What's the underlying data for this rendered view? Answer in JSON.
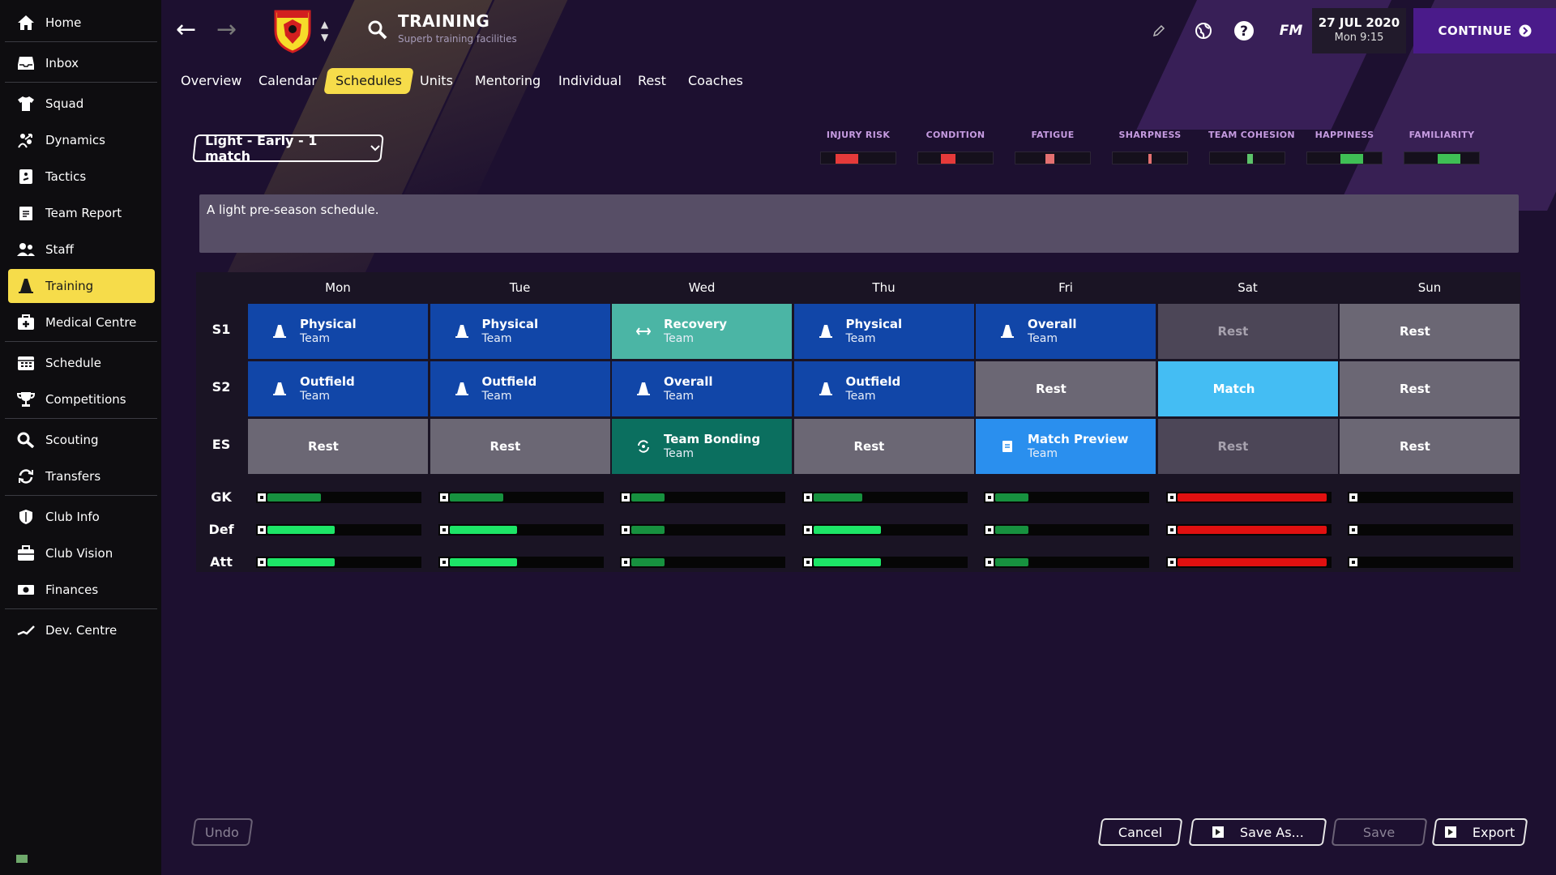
{
  "sidebar": {
    "items": [
      {
        "label": "Home",
        "icon": "home-icon"
      },
      {
        "label": "Inbox",
        "icon": "inbox-icon"
      },
      {
        "label": "Squad",
        "icon": "shirt-icon"
      },
      {
        "label": "Dynamics",
        "icon": "dynamics-icon"
      },
      {
        "label": "Tactics",
        "icon": "tactics-board-icon"
      },
      {
        "label": "Team Report",
        "icon": "report-icon"
      },
      {
        "label": "Staff",
        "icon": "staff-icon"
      },
      {
        "label": "Training",
        "icon": "training-cone-icon",
        "active": true
      },
      {
        "label": "Medical Centre",
        "icon": "medical-kit-icon"
      },
      {
        "label": "Schedule",
        "icon": "calendar-icon"
      },
      {
        "label": "Competitions",
        "icon": "trophy-icon"
      },
      {
        "label": "Scouting",
        "icon": "magnifier-icon"
      },
      {
        "label": "Transfers",
        "icon": "transfer-arrows-icon"
      },
      {
        "label": "Club Info",
        "icon": "shield-icon"
      },
      {
        "label": "Club Vision",
        "icon": "briefcase-icon"
      },
      {
        "label": "Finances",
        "icon": "money-icon"
      },
      {
        "label": "Dev. Centre",
        "icon": "growth-chart-icon"
      }
    ]
  },
  "header": {
    "title": "TRAINING",
    "subtitle": "Superb training facilities",
    "fm_label": "FM",
    "date": "27 JUL 2020",
    "time": "Mon 9:15",
    "continue_label": "CONTINUE"
  },
  "tabs": [
    "Overview",
    "Calendar",
    "Schedules",
    "Units",
    "Mentoring",
    "Individual",
    "Rest",
    "Coaches"
  ],
  "active_tab": "Schedules",
  "schedule_select": "Light - Early - 1 match",
  "meters": [
    {
      "label": "INJURY RISK",
      "color": "#e53a3a",
      "level": 0.3
    },
    {
      "label": "CONDITION",
      "color": "#e53a3a",
      "level": 0.2
    },
    {
      "label": "FATIGUE",
      "color": "#e37070",
      "level": 0.12
    },
    {
      "label": "SHARPNESS",
      "color": "#e37070",
      "level": 0.04
    },
    {
      "label": "TEAM COHESION",
      "color": "#5cc36a",
      "level": 0.08
    },
    {
      "label": "HAPPINESS",
      "color": "#3fbf55",
      "level": 0.3
    },
    {
      "label": "FAMILIARITY",
      "color": "#3fbf55",
      "level": 0.3
    }
  ],
  "description": "A light pre-season schedule.",
  "days": [
    "Mon",
    "Tue",
    "Wed",
    "Thu",
    "Fri",
    "Sat",
    "Sun"
  ],
  "rows": [
    {
      "label": "S1",
      "cells": [
        {
          "name": "Physical",
          "sub": "Team",
          "type": "physical"
        },
        {
          "name": "Physical",
          "sub": "Team",
          "type": "physical"
        },
        {
          "name": "Recovery",
          "sub": "Team",
          "type": "recovery"
        },
        {
          "name": "Physical",
          "sub": "Team",
          "type": "physical"
        },
        {
          "name": "Overall",
          "sub": "Team",
          "type": "physical"
        },
        {
          "name": "Rest",
          "type": "rest-dim"
        },
        {
          "name": "Rest",
          "type": "rest"
        }
      ]
    },
    {
      "label": "S2",
      "cells": [
        {
          "name": "Outfield",
          "sub": "Team",
          "type": "physical"
        },
        {
          "name": "Outfield",
          "sub": "Team",
          "type": "physical"
        },
        {
          "name": "Overall",
          "sub": "Team",
          "type": "physical"
        },
        {
          "name": "Outfield",
          "sub": "Team",
          "type": "physical"
        },
        {
          "name": "Rest",
          "type": "rest"
        },
        {
          "name": "Match",
          "type": "match"
        },
        {
          "name": "Rest",
          "type": "rest"
        }
      ]
    },
    {
      "label": "ES",
      "cells": [
        {
          "name": "Rest",
          "type": "rest"
        },
        {
          "name": "Rest",
          "type": "rest"
        },
        {
          "name": "Team Bonding",
          "sub": "Team",
          "type": "bonding"
        },
        {
          "name": "Rest",
          "type": "rest"
        },
        {
          "name": "Match Preview",
          "sub": "Team",
          "type": "preview"
        },
        {
          "name": "Rest",
          "type": "rest-dim"
        },
        {
          "name": "Rest",
          "type": "rest"
        }
      ]
    }
  ],
  "loads": [
    {
      "label": "GK",
      "values": [
        {
          "level": 0.35,
          "color": "#17913f"
        },
        {
          "level": 0.35,
          "color": "#17913f"
        },
        {
          "level": 0.22,
          "color": "#17913f"
        },
        {
          "level": 0.32,
          "color": "#17913f"
        },
        {
          "level": 0.22,
          "color": "#17913f"
        },
        {
          "level": 0.98,
          "color": "#e01010"
        },
        {
          "level": 0,
          "color": "#000000"
        }
      ]
    },
    {
      "label": "Def",
      "values": [
        {
          "level": 0.44,
          "color": "#1de567"
        },
        {
          "level": 0.44,
          "color": "#1de567"
        },
        {
          "level": 0.22,
          "color": "#17913f"
        },
        {
          "level": 0.44,
          "color": "#1de567"
        },
        {
          "level": 0.22,
          "color": "#17913f"
        },
        {
          "level": 0.98,
          "color": "#e01010"
        },
        {
          "level": 0,
          "color": "#000000"
        }
      ]
    },
    {
      "label": "Att",
      "values": [
        {
          "level": 0.44,
          "color": "#1de567"
        },
        {
          "level": 0.44,
          "color": "#1de567"
        },
        {
          "level": 0.22,
          "color": "#17913f"
        },
        {
          "level": 0.44,
          "color": "#1de567"
        },
        {
          "level": 0.22,
          "color": "#17913f"
        },
        {
          "level": 0.98,
          "color": "#e01010"
        },
        {
          "level": 0,
          "color": "#000000"
        }
      ]
    }
  ],
  "buttons": {
    "undo": "Undo",
    "cancel": "Cancel",
    "save_as": "Save As...",
    "save": "Save",
    "export": "Export"
  },
  "colors": {
    "accent_yellow": "#f6dc4a",
    "physical": "#1146a8",
    "recovery": "#4bb5a5",
    "bonding": "#0b6f5f",
    "preview": "#2a8fee",
    "match": "#44bdf3",
    "rest": "#6b6774",
    "rest_dim": "#4c4657",
    "continue": "#4a1b8a"
  }
}
